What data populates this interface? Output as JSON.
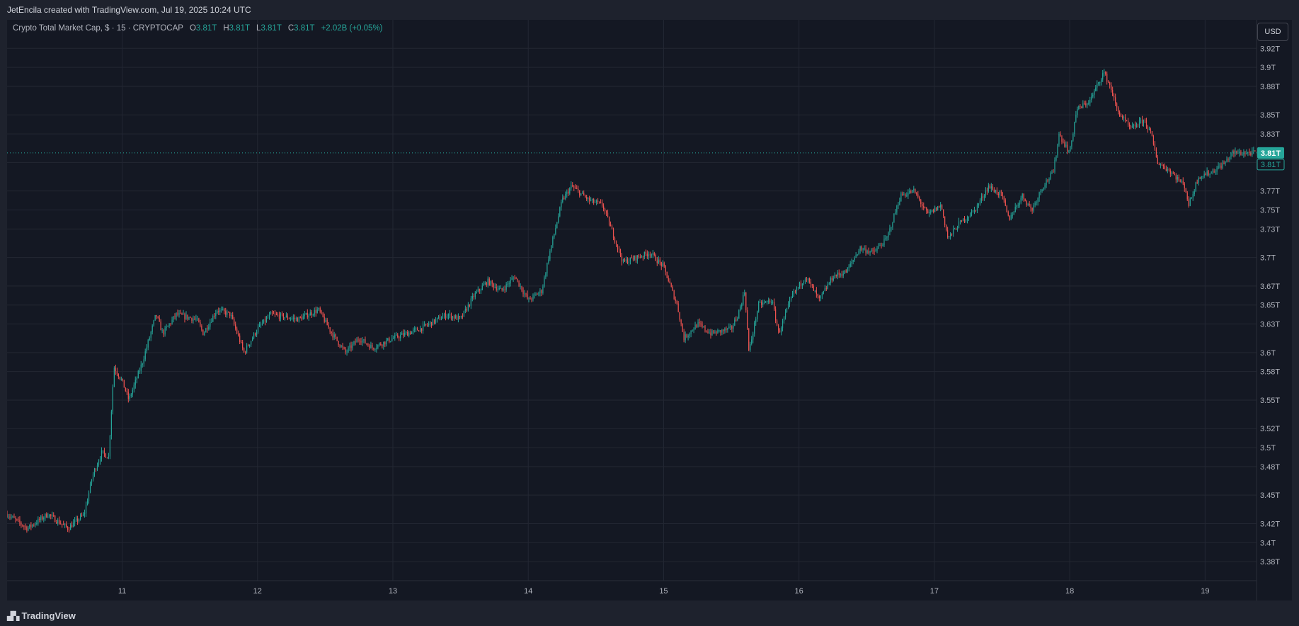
{
  "header": {
    "attribution": "JetEncila created with TradingView.com, Jul 19, 2025 10:24 UTC"
  },
  "legend": {
    "symbol": "Crypto Total Market Cap, $ · 15 · CRYPTOCAP",
    "o_label": "O",
    "o_value": "3.81T",
    "h_label": "H",
    "h_value": "3.81T",
    "l_label": "L",
    "l_value": "3.81T",
    "c_label": "C",
    "c_value": "3.81T",
    "change": "+2.02B (+0.05%)"
  },
  "toolbar": {
    "currency_label": "USD"
  },
  "footer": {
    "brand": "TradingView",
    "brand_icon": "tradingview-logo-icon"
  },
  "colors": {
    "up": "#26a69a",
    "down": "#ef5350",
    "background": "#141823",
    "grid": "#232733",
    "last_price": "#26a69a"
  },
  "chart_data": {
    "type": "candlestick",
    "interval": "15",
    "y_ticks": [
      "3.92T",
      "3.9T",
      "3.88T",
      "3.85T",
      "3.83T",
      "3.8T",
      "3.77T",
      "3.75T",
      "3.73T",
      "3.7T",
      "3.67T",
      "3.65T",
      "3.63T",
      "3.6T",
      "3.58T",
      "3.55T",
      "3.52T",
      "3.5T",
      "3.48T",
      "3.45T",
      "3.42T",
      "3.4T",
      "3.38T"
    ],
    "x_ticks": [
      "11",
      "12",
      "13",
      "14",
      "15",
      "16",
      "17",
      "18",
      "19"
    ],
    "ylim": [
      3.36,
      3.95
    ],
    "xlim": [
      10.15,
      19.38
    ],
    "last_price_label": "3.81T",
    "prev_close_label": "3.81T",
    "last_price": 3.81,
    "grid": true,
    "path": [
      [
        10.15,
        3.43
      ],
      [
        10.3,
        3.415
      ],
      [
        10.45,
        3.43
      ],
      [
        10.6,
        3.415
      ],
      [
        10.72,
        3.43
      ],
      [
        10.78,
        3.47
      ],
      [
        10.85,
        3.495
      ],
      [
        10.9,
        3.49
      ],
      [
        10.94,
        3.585
      ],
      [
        11.0,
        3.57
      ],
      [
        11.05,
        3.55
      ],
      [
        11.15,
        3.59
      ],
      [
        11.25,
        3.64
      ],
      [
        11.3,
        3.62
      ],
      [
        11.4,
        3.64
      ],
      [
        11.55,
        3.635
      ],
      [
        11.6,
        3.62
      ],
      [
        11.7,
        3.645
      ],
      [
        11.8,
        3.64
      ],
      [
        11.9,
        3.6
      ],
      [
        12.0,
        3.625
      ],
      [
        12.1,
        3.64
      ],
      [
        12.3,
        3.635
      ],
      [
        12.45,
        3.645
      ],
      [
        12.55,
        3.62
      ],
      [
        12.65,
        3.6
      ],
      [
        12.75,
        3.615
      ],
      [
        12.85,
        3.605
      ],
      [
        13.0,
        3.615
      ],
      [
        13.2,
        3.625
      ],
      [
        13.4,
        3.64
      ],
      [
        13.5,
        3.635
      ],
      [
        13.6,
        3.66
      ],
      [
        13.7,
        3.675
      ],
      [
        13.8,
        3.665
      ],
      [
        13.9,
        3.68
      ],
      [
        14.0,
        3.655
      ],
      [
        14.1,
        3.665
      ],
      [
        14.15,
        3.7
      ],
      [
        14.25,
        3.76
      ],
      [
        14.32,
        3.775
      ],
      [
        14.45,
        3.76
      ],
      [
        14.55,
        3.755
      ],
      [
        14.6,
        3.735
      ],
      [
        14.7,
        3.695
      ],
      [
        14.8,
        3.7
      ],
      [
        14.9,
        3.705
      ],
      [
        15.0,
        3.69
      ],
      [
        15.1,
        3.65
      ],
      [
        15.15,
        3.615
      ],
      [
        15.25,
        3.63
      ],
      [
        15.35,
        3.62
      ],
      [
        15.5,
        3.625
      ],
      [
        15.55,
        3.64
      ],
      [
        15.6,
        3.665
      ],
      [
        15.63,
        3.6
      ],
      [
        15.7,
        3.65
      ],
      [
        15.8,
        3.655
      ],
      [
        15.85,
        3.62
      ],
      [
        15.95,
        3.66
      ],
      [
        16.05,
        3.68
      ],
      [
        16.15,
        3.655
      ],
      [
        16.25,
        3.68
      ],
      [
        16.35,
        3.685
      ],
      [
        16.45,
        3.71
      ],
      [
        16.55,
        3.705
      ],
      [
        16.65,
        3.72
      ],
      [
        16.75,
        3.765
      ],
      [
        16.85,
        3.77
      ],
      [
        16.95,
        3.745
      ],
      [
        17.05,
        3.755
      ],
      [
        17.1,
        3.72
      ],
      [
        17.18,
        3.735
      ],
      [
        17.3,
        3.75
      ],
      [
        17.4,
        3.775
      ],
      [
        17.5,
        3.765
      ],
      [
        17.55,
        3.74
      ],
      [
        17.65,
        3.765
      ],
      [
        17.72,
        3.75
      ],
      [
        17.8,
        3.775
      ],
      [
        17.88,
        3.79
      ],
      [
        17.92,
        3.83
      ],
      [
        18.0,
        3.81
      ],
      [
        18.05,
        3.855
      ],
      [
        18.15,
        3.865
      ],
      [
        18.25,
        3.895
      ],
      [
        18.3,
        3.88
      ],
      [
        18.35,
        3.855
      ],
      [
        18.45,
        3.835
      ],
      [
        18.55,
        3.845
      ],
      [
        18.6,
        3.83
      ],
      [
        18.65,
        3.8
      ],
      [
        18.75,
        3.79
      ],
      [
        18.85,
        3.775
      ],
      [
        18.88,
        3.755
      ],
      [
        18.95,
        3.785
      ],
      [
        19.05,
        3.79
      ],
      [
        19.15,
        3.8
      ],
      [
        19.2,
        3.81
      ],
      [
        19.3,
        3.81
      ],
      [
        19.38,
        3.81
      ]
    ]
  }
}
